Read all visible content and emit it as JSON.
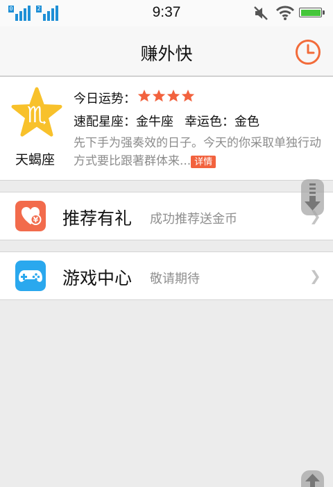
{
  "status_bar": {
    "time": "9:37",
    "sim1_label": "0",
    "sim2_label": "2",
    "battery_level": 1.0,
    "battery_color": "#45c63a"
  },
  "header": {
    "title": "赚外快",
    "history_icon": "clock-history-icon",
    "accent_color": "#f26b3a"
  },
  "horoscope": {
    "sign_icon": "scorpio-star-icon",
    "sign_name": "天蝎座",
    "fortune_label": "今日运势：",
    "fortune_stars": 4,
    "match_text": "速配星座：金牛座",
    "lucky_color_text": "幸运色：金色",
    "description": "先下手为强奏效的日子。今天的你采取单独行动方式要比跟著群体来...",
    "detail_label": "详情"
  },
  "menu": [
    {
      "icon": "heart-gift-icon",
      "icon_color": "#f26b4c",
      "title": "推荐有礼",
      "subtitle": "成功推荐送金币"
    },
    {
      "icon": "gamepad-icon",
      "icon_color": "#2aa8ee",
      "title": "游戏中心",
      "subtitle": "敬请期待"
    }
  ],
  "controls": {
    "scroll_down_icon": "scroll-down-arrow-icon",
    "scroll_up_icon": "scroll-up-arrow-icon"
  }
}
